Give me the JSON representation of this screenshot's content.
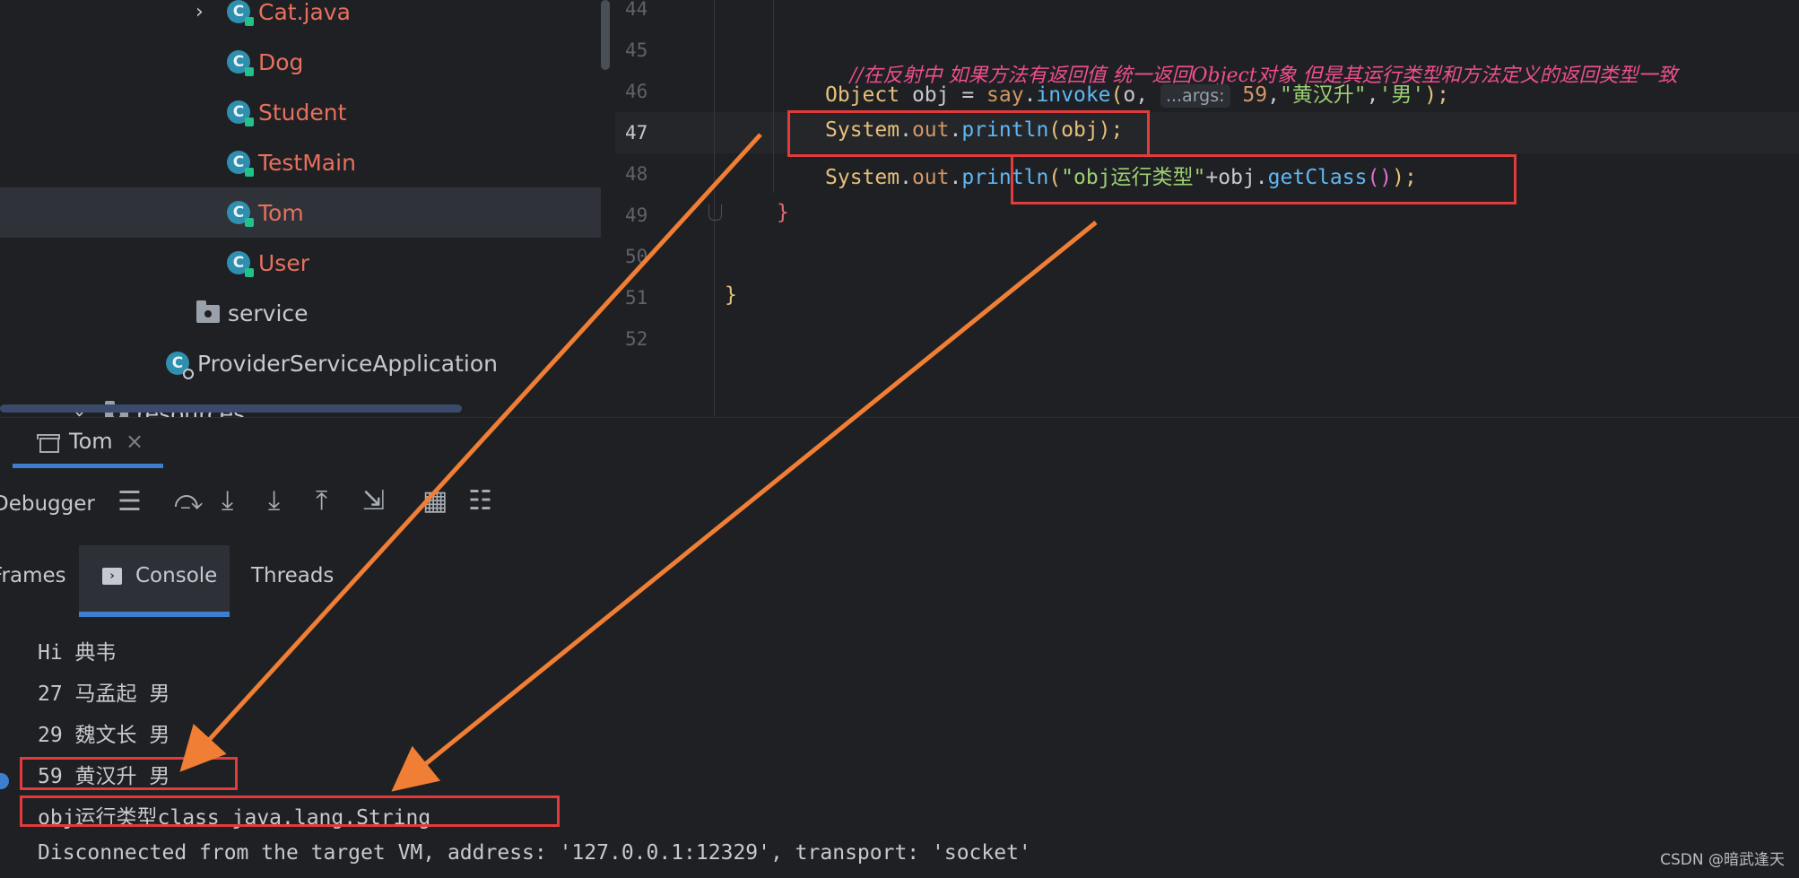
{
  "project_tree": {
    "items": [
      {
        "label": "Cat.java",
        "kind": "class",
        "expanded": false,
        "selected": false
      },
      {
        "label": "Dog",
        "kind": "class",
        "selected": false
      },
      {
        "label": "Student",
        "kind": "class",
        "selected": false
      },
      {
        "label": "TestMain",
        "kind": "class",
        "selected": false
      },
      {
        "label": "Tom",
        "kind": "class",
        "selected": true
      },
      {
        "label": "User",
        "kind": "class",
        "selected": false
      },
      {
        "label": "service",
        "kind": "package"
      },
      {
        "label": "ProviderServiceApplication",
        "kind": "spring-app"
      },
      {
        "label": "resources",
        "kind": "folder",
        "expanded": true
      }
    ]
  },
  "editor": {
    "line_numbers": [
      "44",
      "45",
      "46",
      "47",
      "48",
      "49",
      "50",
      "51",
      "52"
    ],
    "current_line": "47",
    "code": {
      "l45_comment": "//在反射中 如果方法有返回值 统一返回Object对象 但是其运行类型和方法定义的返回类型一致",
      "l46_type": "Object",
      "l46_var": " obj = ",
      "l46_say": "say",
      "l46_dot": ".",
      "l46_invoke": "invoke",
      "l46_open": "(",
      "l46_o": "o, ",
      "l46_hint": "...args:",
      "l46_num": " 59",
      "l46_comma1": ",",
      "l46_str1": "\"黄汉升\"",
      "l46_comma2": ",",
      "l46_char": "'男'",
      "l46_close": ");",
      "l47_system": "System",
      "l47_dot1": ".",
      "l47_out": "out",
      "l47_dot2": ".",
      "l47_println": "println",
      "l47_args": "(obj);",
      "l48_system": "System",
      "l48_dot1": ".",
      "l48_out": "out",
      "l48_dot2": ".",
      "l48_println": "println",
      "l48_open": "(",
      "l48_str": "\"obj运行类型\"",
      "l48_plus": "+obj.",
      "l48_getclass": "getClass",
      "l48_paren": "()",
      "l48_close": ");",
      "l49_brace": "}",
      "l51_brace": "}"
    }
  },
  "run_panel": {
    "tab_label": "Tom",
    "close_glyph": "×",
    "toolbar_label": "Debugger",
    "sub_tabs": [
      "Frames",
      "Console",
      "Threads"
    ],
    "active_sub_tab": "Console"
  },
  "console": {
    "lines": [
      "Hi 典韦",
      "27 马孟起 男",
      "29 魏文长 男",
      "59 黄汉升 男",
      "obj运行类型class java.lang.String",
      "Disconnected from the target VM, address: '127.0.0.1:12329', transport: 'socket'"
    ]
  },
  "watermark": "CSDN @暗武逢天",
  "colors": {
    "highlight_box": "#e23b3b",
    "arrow": "#f07f35",
    "accent": "#3d7fcf"
  }
}
